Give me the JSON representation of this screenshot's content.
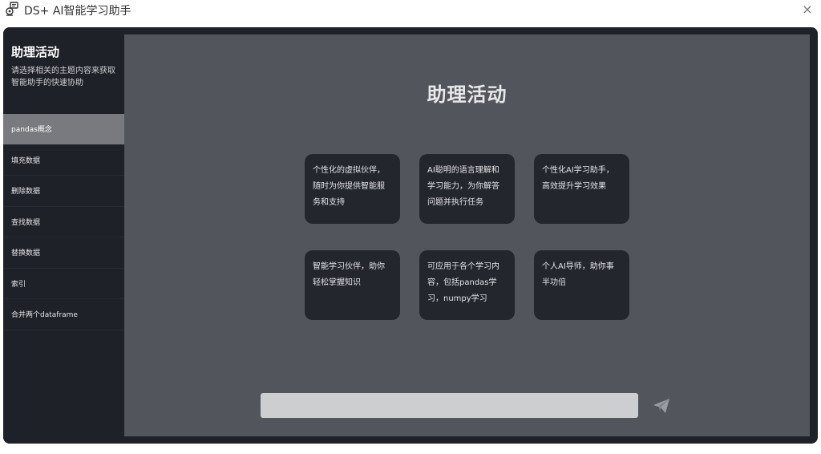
{
  "window": {
    "title": "DS+ AI智能学习助手",
    "close_label": "×"
  },
  "sidebar": {
    "title": "助理活动",
    "description": "请选择相关的主题内容来获取智能助手的快速协助",
    "items": [
      {
        "label": "pandas概念",
        "active": true
      },
      {
        "label": "填充数据"
      },
      {
        "label": "删除数据"
      },
      {
        "label": "查找数据"
      },
      {
        "label": "替换数据"
      },
      {
        "label": "索引"
      },
      {
        "label": "合并两个dataframe"
      }
    ]
  },
  "main": {
    "title": "助理活动",
    "cards": [
      {
        "text": "个性化的虚拟伙伴，随时为你提供智能服务和支持"
      },
      {
        "text": "AI聪明的语言理解和学习能力，为你解答问题并执行任务"
      },
      {
        "text": "个性化AI学习助手，高效提升学习效果"
      },
      {
        "text": "智能学习伙伴，助你轻松掌握知识"
      },
      {
        "text": "可应用于各个学习内容，包括pandas学习，numpy学习"
      },
      {
        "text": "个人AI导师，助你事半功倍"
      }
    ],
    "input": {
      "value": "",
      "placeholder": ""
    },
    "send_icon": "paper-plane-icon"
  },
  "colors": {
    "frame": "#1f2128",
    "panel": "#53555d",
    "card": "#24262d",
    "active_item": "#787a80",
    "input": "#cdcecf"
  }
}
